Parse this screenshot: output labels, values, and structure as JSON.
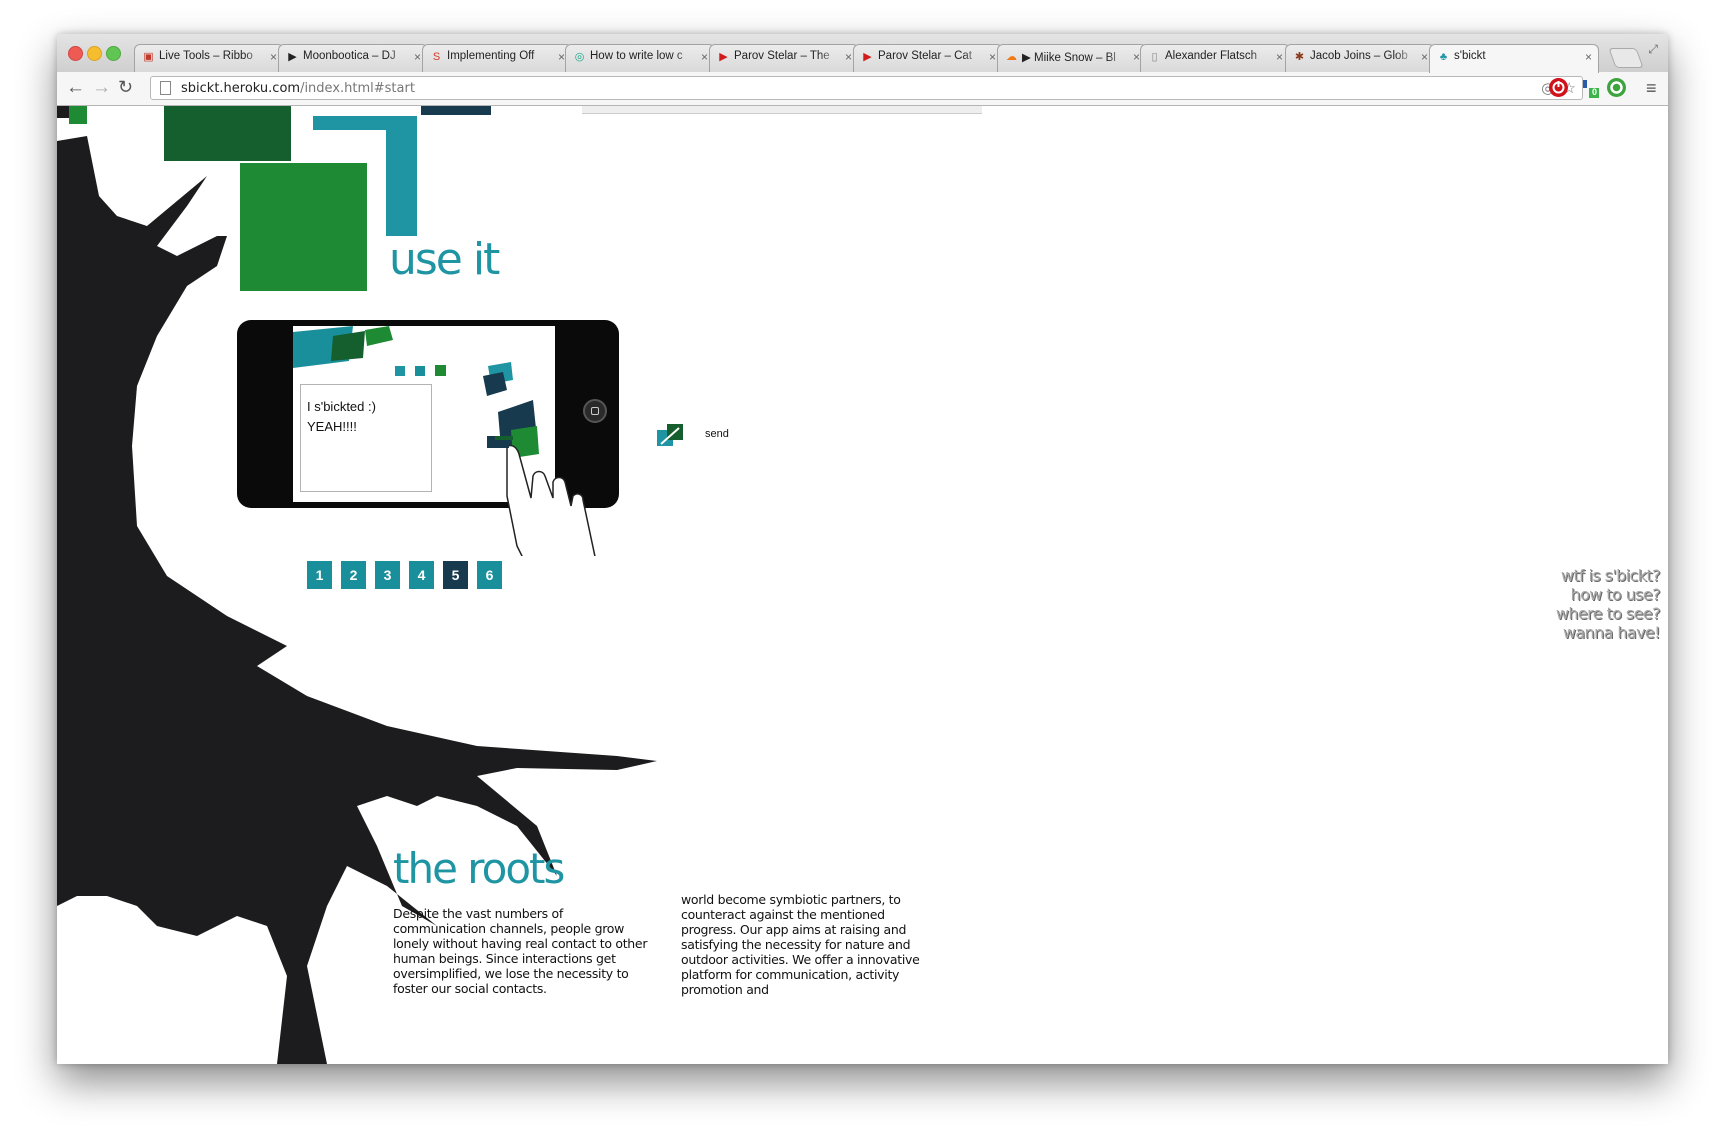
{
  "browser": {
    "tabs": [
      {
        "title": "Live Tools – Ribbo",
        "icon": "basket-icon",
        "color": "#c0392b"
      },
      {
        "title": "Moonbootica – DJ",
        "icon": "play-icon",
        "color": "#222222"
      },
      {
        "title": "Implementing Off",
        "icon": "s-logo-icon",
        "color": "#d63a2b"
      },
      {
        "title": "How to write low c",
        "icon": "g-circle-icon",
        "color": "#1aa88a"
      },
      {
        "title": "Parov Stelar – The",
        "icon": "youtube-icon",
        "color": "#d21c1c"
      },
      {
        "title": "Parov Stelar – Cat",
        "icon": "youtube-icon",
        "color": "#d21c1c"
      },
      {
        "title": "▶ Miike Snow – Bl",
        "icon": "soundcloud-icon",
        "color": "#f07a1a"
      },
      {
        "title": "Alexander Flatsch",
        "icon": "document-icon",
        "color": "#888888"
      },
      {
        "title": "Jacob Joins – Glob",
        "icon": "figure-icon",
        "color": "#8b3a1a"
      },
      {
        "title": "s'bickt",
        "icon": "tree-icon",
        "color": "#1f95a4",
        "active": true
      }
    ],
    "url_host": "sbickt.heroku.com",
    "url_path": "/index.html#start",
    "ext_count": "0"
  },
  "page": {
    "use_heading": "use it",
    "roots_heading": "the roots",
    "phone_note": "I s'bickted :)\nYEAH!!!!",
    "send_label": "send",
    "pagination": [
      "1",
      "2",
      "3",
      "4",
      "5",
      "6"
    ],
    "active_page": "5",
    "side_nav": [
      "wtf is s'bickt?",
      "how to use?",
      "where to see?",
      "wanna have!"
    ],
    "para_left": "Despite the vast numbers of communication channels, people grow lonely without having real contact to other human beings. Since interactions get oversimplified, we lose the necessity to foster our social contacts.",
    "para_right": "world become symbiotic partners, to counteract against the mentioned progress. Our app aims at raising and satisfying the necessity for nature and outdoor activities. We offer a innovative platform for communication, activity promotion and"
  },
  "colors": {
    "dark_green": "#155e2e",
    "green": "#1e8a34",
    "teal": "#1f95a4",
    "navy": "#173a4e",
    "tree": "#1c1c1e"
  }
}
